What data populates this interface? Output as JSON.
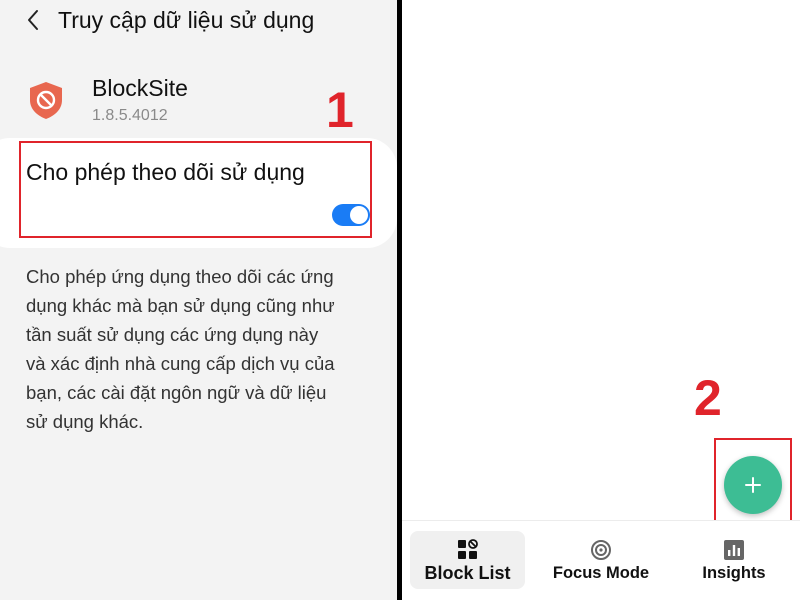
{
  "left_panel": {
    "title": "Truy cập dữ liệu sử dụng",
    "app": {
      "name": "BlockSite",
      "version": "1.8.5.4012"
    },
    "step_number": "1",
    "setting": {
      "label": "Cho phép theo dõi sử dụng",
      "enabled": true
    },
    "description": "Cho phép ứng dụng theo dõi các ứng\ndụng khác mà bạn sử dụng cũng như\ntần suất sử dụng các ứng dụng này\nvà xác định nhà cung cấp dịch vụ của\nbạn, các cài đặt ngôn ngữ và dữ liệu\nsử dụng khác."
  },
  "right_panel": {
    "step_number": "2",
    "fab_icon": "plus-icon",
    "bottom_nav": [
      {
        "label": "Block List",
        "icon": "block-list-icon",
        "active": true
      },
      {
        "label": "Focus Mode",
        "icon": "target-icon",
        "active": false
      },
      {
        "label": "Insights",
        "icon": "bar-chart-icon",
        "active": false
      }
    ]
  },
  "colors": {
    "annotation_red": "#e0242b",
    "toggle_blue": "#1a7cf5",
    "fab_green": "#3dbd94",
    "shield_red": "#e8674f"
  }
}
